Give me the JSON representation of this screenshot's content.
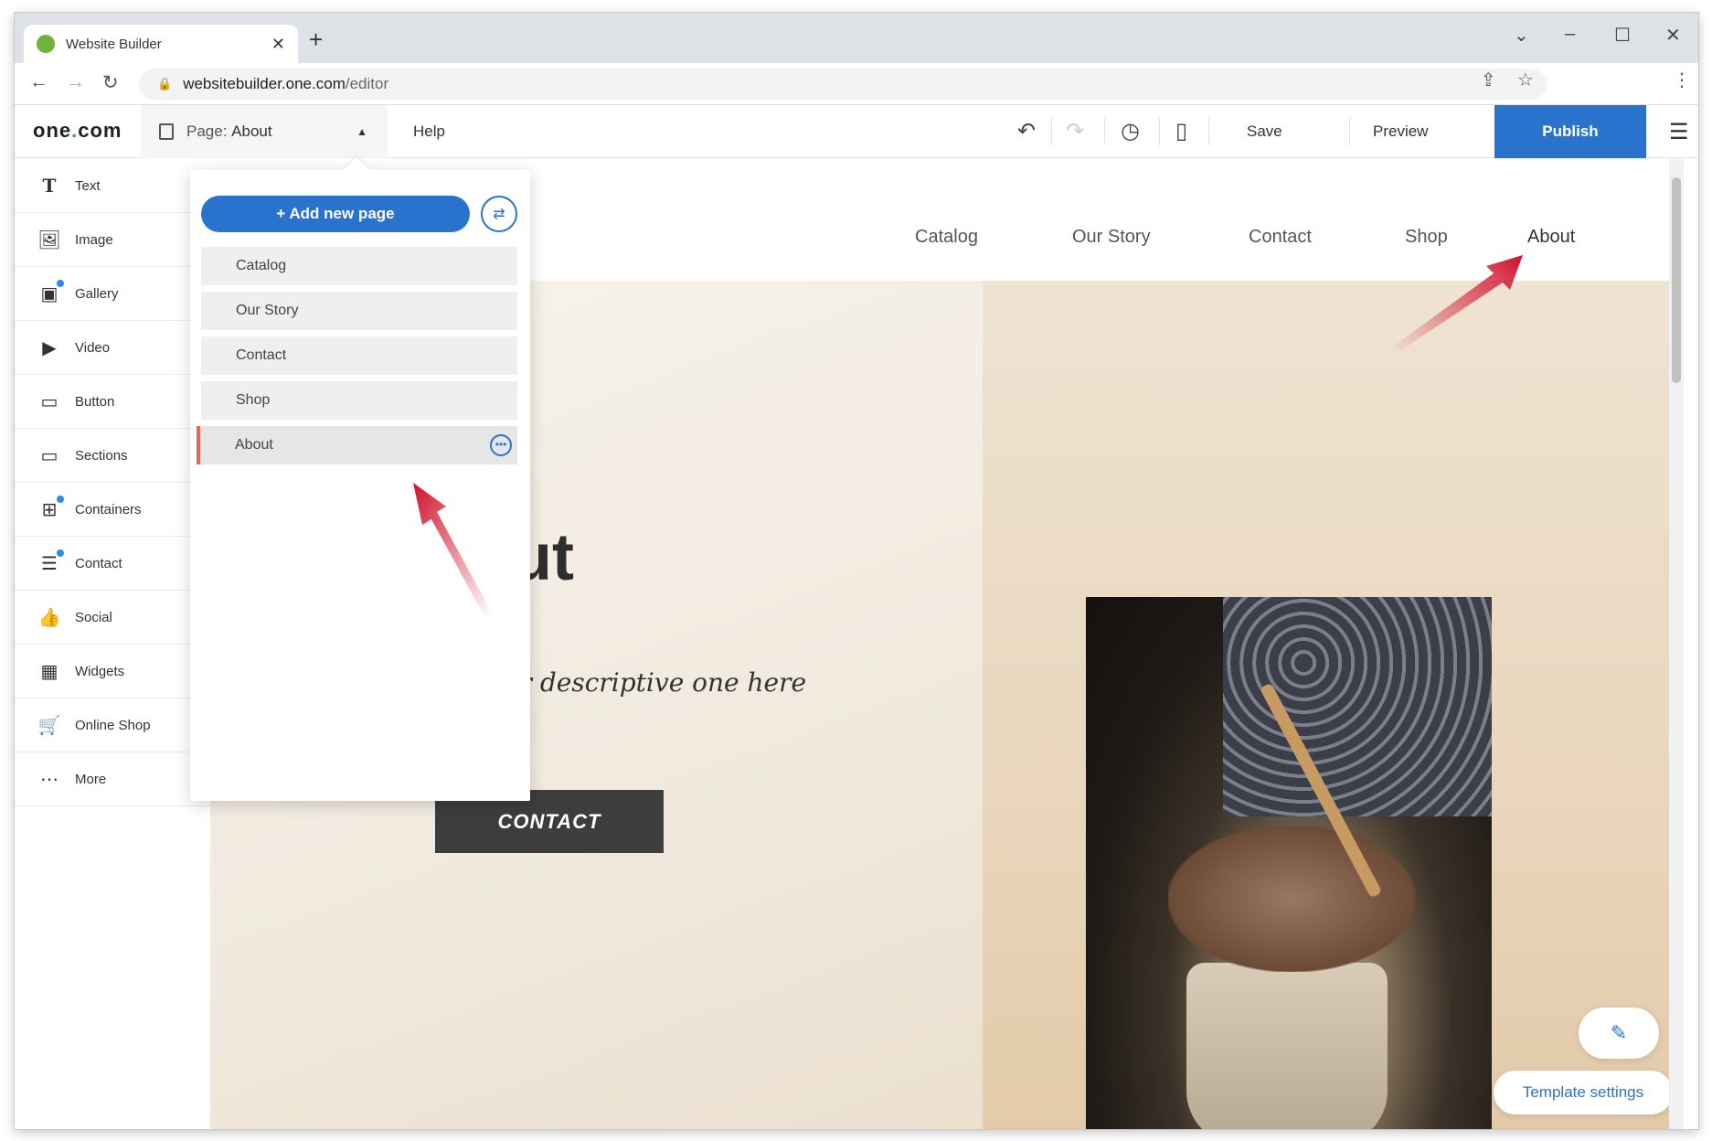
{
  "browser": {
    "tab_title": "Website Builder",
    "url_host": "websitebuilder.one.com",
    "url_path": "/editor"
  },
  "toolbar": {
    "logo_text": "one",
    "logo_dot": ".",
    "logo_suffix": "com",
    "page_prefix": "Page: ",
    "page_current": "About",
    "help_label": "Help",
    "save_label": "Save",
    "preview_label": "Preview",
    "publish_label": "Publish"
  },
  "sidebar": {
    "items": [
      {
        "label": "Text",
        "icon": "text-icon",
        "badge": false
      },
      {
        "label": "Image",
        "icon": "image-icon",
        "badge": false
      },
      {
        "label": "Gallery",
        "icon": "gallery-icon",
        "badge": true
      },
      {
        "label": "Video",
        "icon": "video-icon",
        "badge": false
      },
      {
        "label": "Button",
        "icon": "button-icon",
        "badge": false
      },
      {
        "label": "Sections",
        "icon": "sections-icon",
        "badge": false
      },
      {
        "label": "Containers",
        "icon": "containers-icon",
        "badge": true
      },
      {
        "label": "Contact",
        "icon": "contact-icon",
        "badge": true
      },
      {
        "label": "Social",
        "icon": "social-icon",
        "badge": false
      },
      {
        "label": "Widgets",
        "icon": "widgets-icon",
        "badge": false
      },
      {
        "label": "Online Shop",
        "icon": "cart-icon",
        "badge": false
      },
      {
        "label": "More",
        "icon": "more-icon",
        "badge": false
      }
    ]
  },
  "dropdown": {
    "add_page_label": "+ Add new page",
    "pages": [
      "Catalog",
      "Our Story",
      "Contact",
      "Shop",
      "About"
    ],
    "active_page": "About"
  },
  "site": {
    "nav": [
      "Catalog",
      "Our Story",
      "Contact",
      "Shop",
      "About"
    ],
    "hero_title": "out",
    "hero_subtitle": "er descriptive one here",
    "cta_label": "CONTACT",
    "template_settings_label": "Template settings"
  },
  "colors": {
    "accent": "#2a73cc",
    "active_marker": "#e8655a",
    "annotation": "#d0112b"
  }
}
